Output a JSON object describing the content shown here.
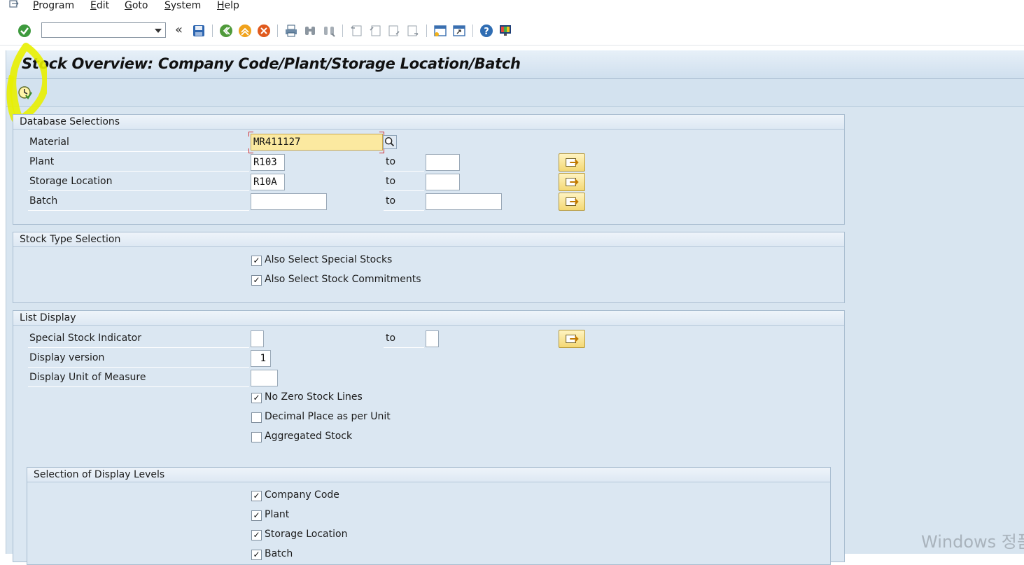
{
  "menu": {
    "items": [
      {
        "label": "Program",
        "underline": "P"
      },
      {
        "label": "Edit",
        "underline": "E"
      },
      {
        "label": "Goto",
        "underline": "G"
      },
      {
        "label": "System",
        "underline": "S"
      },
      {
        "label": "Help",
        "underline": "H"
      }
    ]
  },
  "toolbar": {
    "command_value": "",
    "icons": [
      "enter-icon",
      "save-icon",
      "back-icon",
      "exit-icon",
      "cancel-icon",
      "print-icon",
      "find-icon",
      "find-next-icon",
      "first-page-icon",
      "previous-page-icon",
      "next-page-icon",
      "last-page-icon",
      "new-session-icon",
      "shortcut-icon",
      "help-icon",
      "customize-layout-icon"
    ]
  },
  "page": {
    "title": "Stock Overview: Company Code/Plant/Storage Location/Batch",
    "execute_icon": "execute-clock-icon"
  },
  "database_selections": {
    "title": "Database Selections",
    "material": {
      "label": "Material",
      "value": "MR411127"
    },
    "plant": {
      "label": "Plant",
      "from": "R103",
      "to_label": "to",
      "to": ""
    },
    "storage_location": {
      "label": "Storage Location",
      "from": "R10A",
      "to_label": "to",
      "to": ""
    },
    "batch": {
      "label": "Batch",
      "from": "",
      "to_label": "to",
      "to": ""
    }
  },
  "stock_type_selection": {
    "title": "Stock Type Selection",
    "options": [
      {
        "label": "Also Select Special Stocks",
        "checked": true
      },
      {
        "label": "Also Select Stock Commitments",
        "checked": true
      }
    ]
  },
  "list_display": {
    "title": "List Display",
    "special_stock_indicator": {
      "label": "Special Stock Indicator",
      "from": "",
      "to_label": "to",
      "to": ""
    },
    "display_version": {
      "label": "Display version",
      "value": "1"
    },
    "display_unit": {
      "label": "Display Unit of Measure",
      "value": ""
    },
    "options": [
      {
        "label": "No Zero Stock Lines",
        "checked": true
      },
      {
        "label": "Decimal Place as per Unit",
        "checked": false
      },
      {
        "label": "Aggregated Stock",
        "checked": false
      }
    ]
  },
  "display_levels": {
    "title": "Selection of Display Levels",
    "options": [
      {
        "label": "Company Code",
        "checked": true
      },
      {
        "label": "Plant",
        "checked": true
      },
      {
        "label": "Storage Location",
        "checked": true
      },
      {
        "label": "Batch",
        "checked": true
      }
    ]
  },
  "watermark": "Windows 정품 인증",
  "checkmark": "✓",
  "colors": {
    "background": "#d8e5f0",
    "required_field": "#fbe9a0",
    "multi_select_button": "#f4d874",
    "highlighter": "#e8f000"
  }
}
